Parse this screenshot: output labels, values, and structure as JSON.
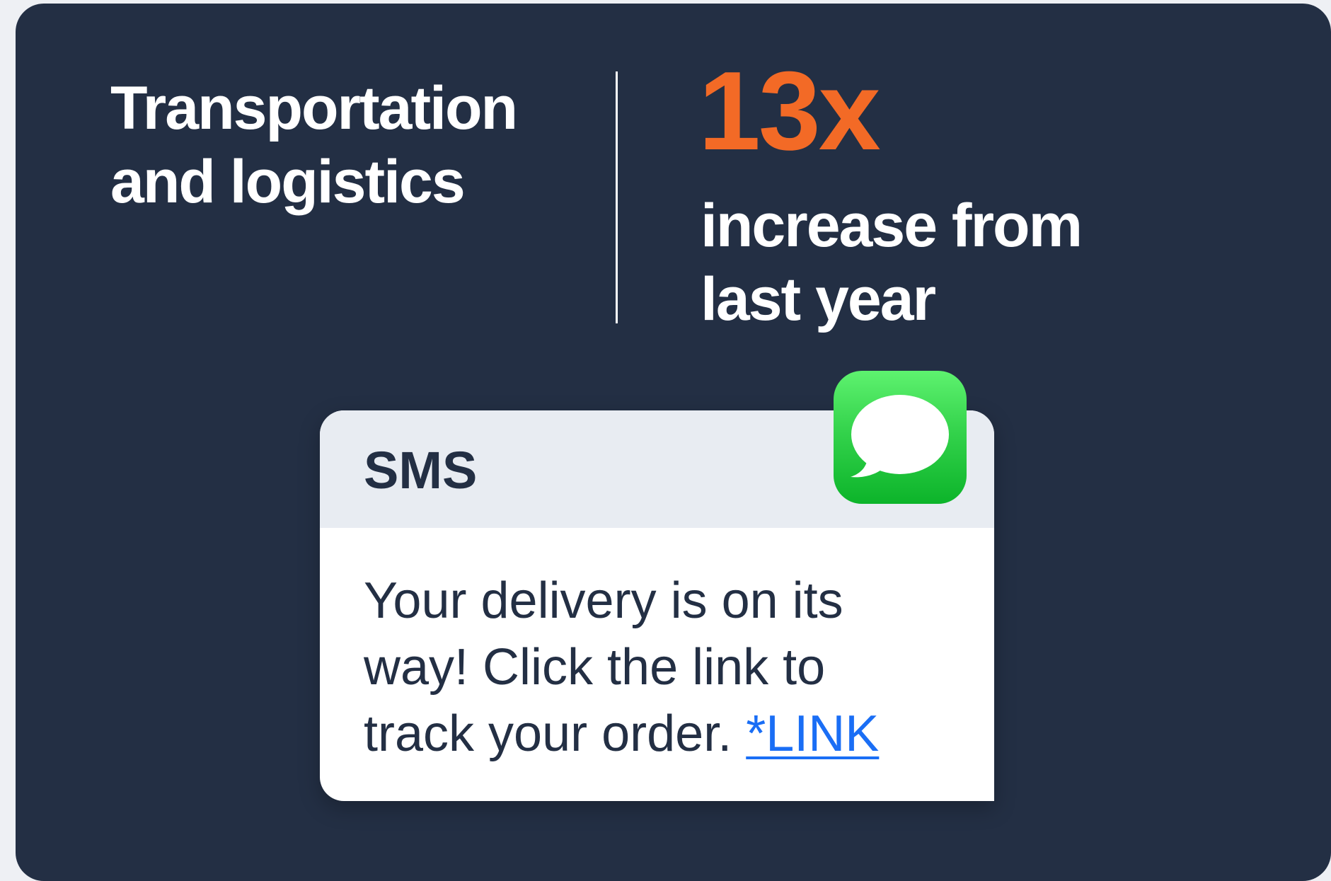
{
  "category": {
    "line1": "Transportation",
    "line2": "and logistics"
  },
  "stat": {
    "value": "13x",
    "caption_line1": "increase from",
    "caption_line2": "last year"
  },
  "sms": {
    "title": "SMS",
    "message_line1": "Your delivery is on its",
    "message_line2": "way! Click the link to",
    "message_line3": "track your order.",
    "link_text": "*LINK"
  },
  "icons": {
    "message_app": "messages-bubble-icon"
  },
  "colors": {
    "background": "#232f44",
    "accent": "#f36a26",
    "link": "#1a6ef5",
    "icon_green": "#34d34c"
  }
}
